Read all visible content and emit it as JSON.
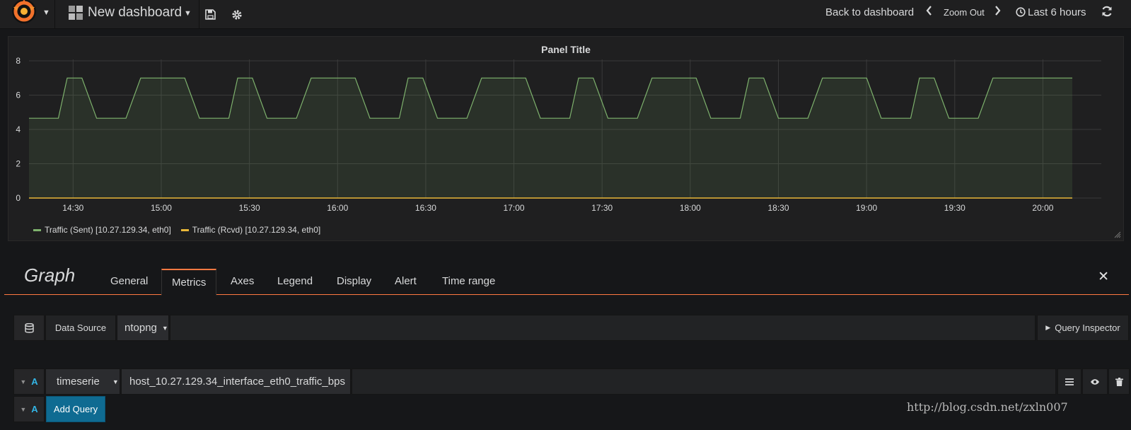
{
  "navbar": {
    "dashboard_title": "New dashboard",
    "back_label": "Back to dashboard",
    "zoom_out_label": "Zoom Out",
    "time_range_label": "Last 6 hours"
  },
  "panel": {
    "title": "Panel Title"
  },
  "chart_data": {
    "type": "area",
    "title": "Panel Title",
    "xlabel": "",
    "ylabel": "",
    "x_ticks": [
      "14:30",
      "15:00",
      "15:30",
      "16:00",
      "16:30",
      "17:00",
      "17:30",
      "18:00",
      "18:30",
      "19:00",
      "19:30",
      "20:00"
    ],
    "y_ticks": [
      0,
      2,
      4,
      6,
      8
    ],
    "ylim": [
      0,
      8
    ],
    "grid": true,
    "legend_position": "bottom-left",
    "series": [
      {
        "name": "Traffic (Sent) [10.27.129.34, eth0]",
        "color": "#7eb26d",
        "x": [
          "14:15",
          "14:25",
          "14:28",
          "14:33",
          "14:38",
          "14:48",
          "14:53",
          "15:08",
          "15:13",
          "15:23",
          "15:26",
          "15:31",
          "15:36",
          "15:46",
          "15:51",
          "16:06",
          "16:11",
          "16:21",
          "16:24",
          "16:29",
          "16:34",
          "16:44",
          "16:49",
          "17:04",
          "17:09",
          "17:19",
          "17:22",
          "17:27",
          "17:32",
          "17:42",
          "17:47",
          "18:02",
          "18:07",
          "18:17",
          "18:20",
          "18:25",
          "18:30",
          "18:40",
          "18:45",
          "19:00",
          "19:05",
          "19:15",
          "19:18",
          "19:23",
          "19:28",
          "19:38",
          "19:43",
          "20:10"
        ],
        "values": [
          4.65,
          4.65,
          7,
          7,
          4.65,
          4.65,
          7,
          7,
          4.65,
          4.65,
          7,
          7,
          4.65,
          4.65,
          7,
          7,
          4.65,
          4.65,
          7,
          7,
          4.65,
          4.65,
          7,
          7,
          4.65,
          4.65,
          7,
          7,
          4.65,
          4.65,
          7,
          7,
          4.65,
          4.65,
          7,
          7,
          4.65,
          4.65,
          7,
          7,
          4.65,
          4.65,
          7,
          7,
          4.65,
          4.65,
          7,
          7
        ]
      },
      {
        "name": "Traffic (Rcvd) [10.27.129.34, eth0]",
        "color": "#eab839",
        "x": [
          "14:15",
          "20:10"
        ],
        "values": [
          0,
          0
        ]
      }
    ]
  },
  "editor": {
    "title": "Graph",
    "tabs": [
      "General",
      "Metrics",
      "Axes",
      "Legend",
      "Display",
      "Alert",
      "Time range"
    ],
    "active_tab": "Metrics"
  },
  "datasource": {
    "label": "Data Source",
    "value": "ntopng",
    "inspector_label": "Query Inspector"
  },
  "query": {
    "ref": "A",
    "type": "timeserie",
    "metric": "host_10.27.129.34_interface_eth0_traffic_bps",
    "add_label": "Add Query",
    "add_ref": "A"
  },
  "watermark": "http://blog.csdn.net/zxln007"
}
